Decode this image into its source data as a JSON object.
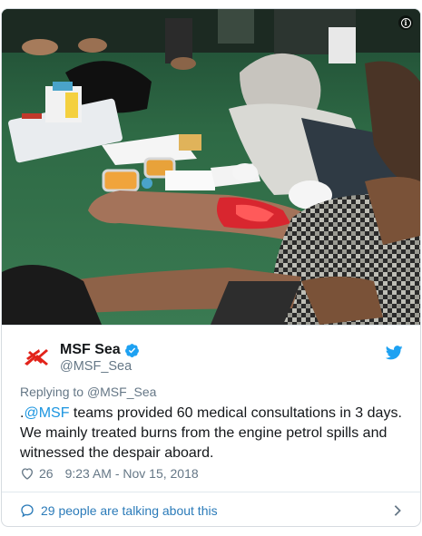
{
  "photo": {
    "alt_icon": "info-icon"
  },
  "account": {
    "display_name": "MSF Sea",
    "handle": "@MSF_Sea",
    "verified": true
  },
  "reply": {
    "prefix": "Replying to ",
    "target": "@MSF_Sea"
  },
  "tweet": {
    "lead": ".",
    "mention": "@MSF",
    "text": " teams provided 60 medical consultations in 3 days. We mainly treated burns from the engine petrol spills and witnessed the despair aboard."
  },
  "meta": {
    "like_count": "26",
    "timestamp": "9:23 AM - Nov 15, 2018"
  },
  "footer": {
    "talking_label": "29 people are talking about this"
  },
  "colors": {
    "brand_red": "#e2231a",
    "link_blue": "#1b95e0",
    "twitter_blue": "#1da1f2",
    "muted_gray": "#657786"
  }
}
